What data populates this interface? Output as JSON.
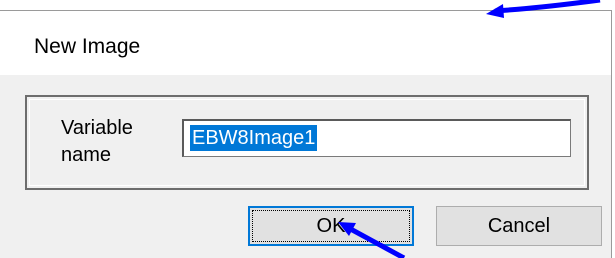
{
  "dialog": {
    "title": "New Image",
    "variable_label": "Variable\nname",
    "variable_value": "EBW8Image1",
    "ok_label": "OK",
    "cancel_label": "Cancel"
  },
  "colors": {
    "selection": "#0078d7",
    "focus_border": "#0078d7",
    "annotation_arrow": "#0000ff"
  }
}
